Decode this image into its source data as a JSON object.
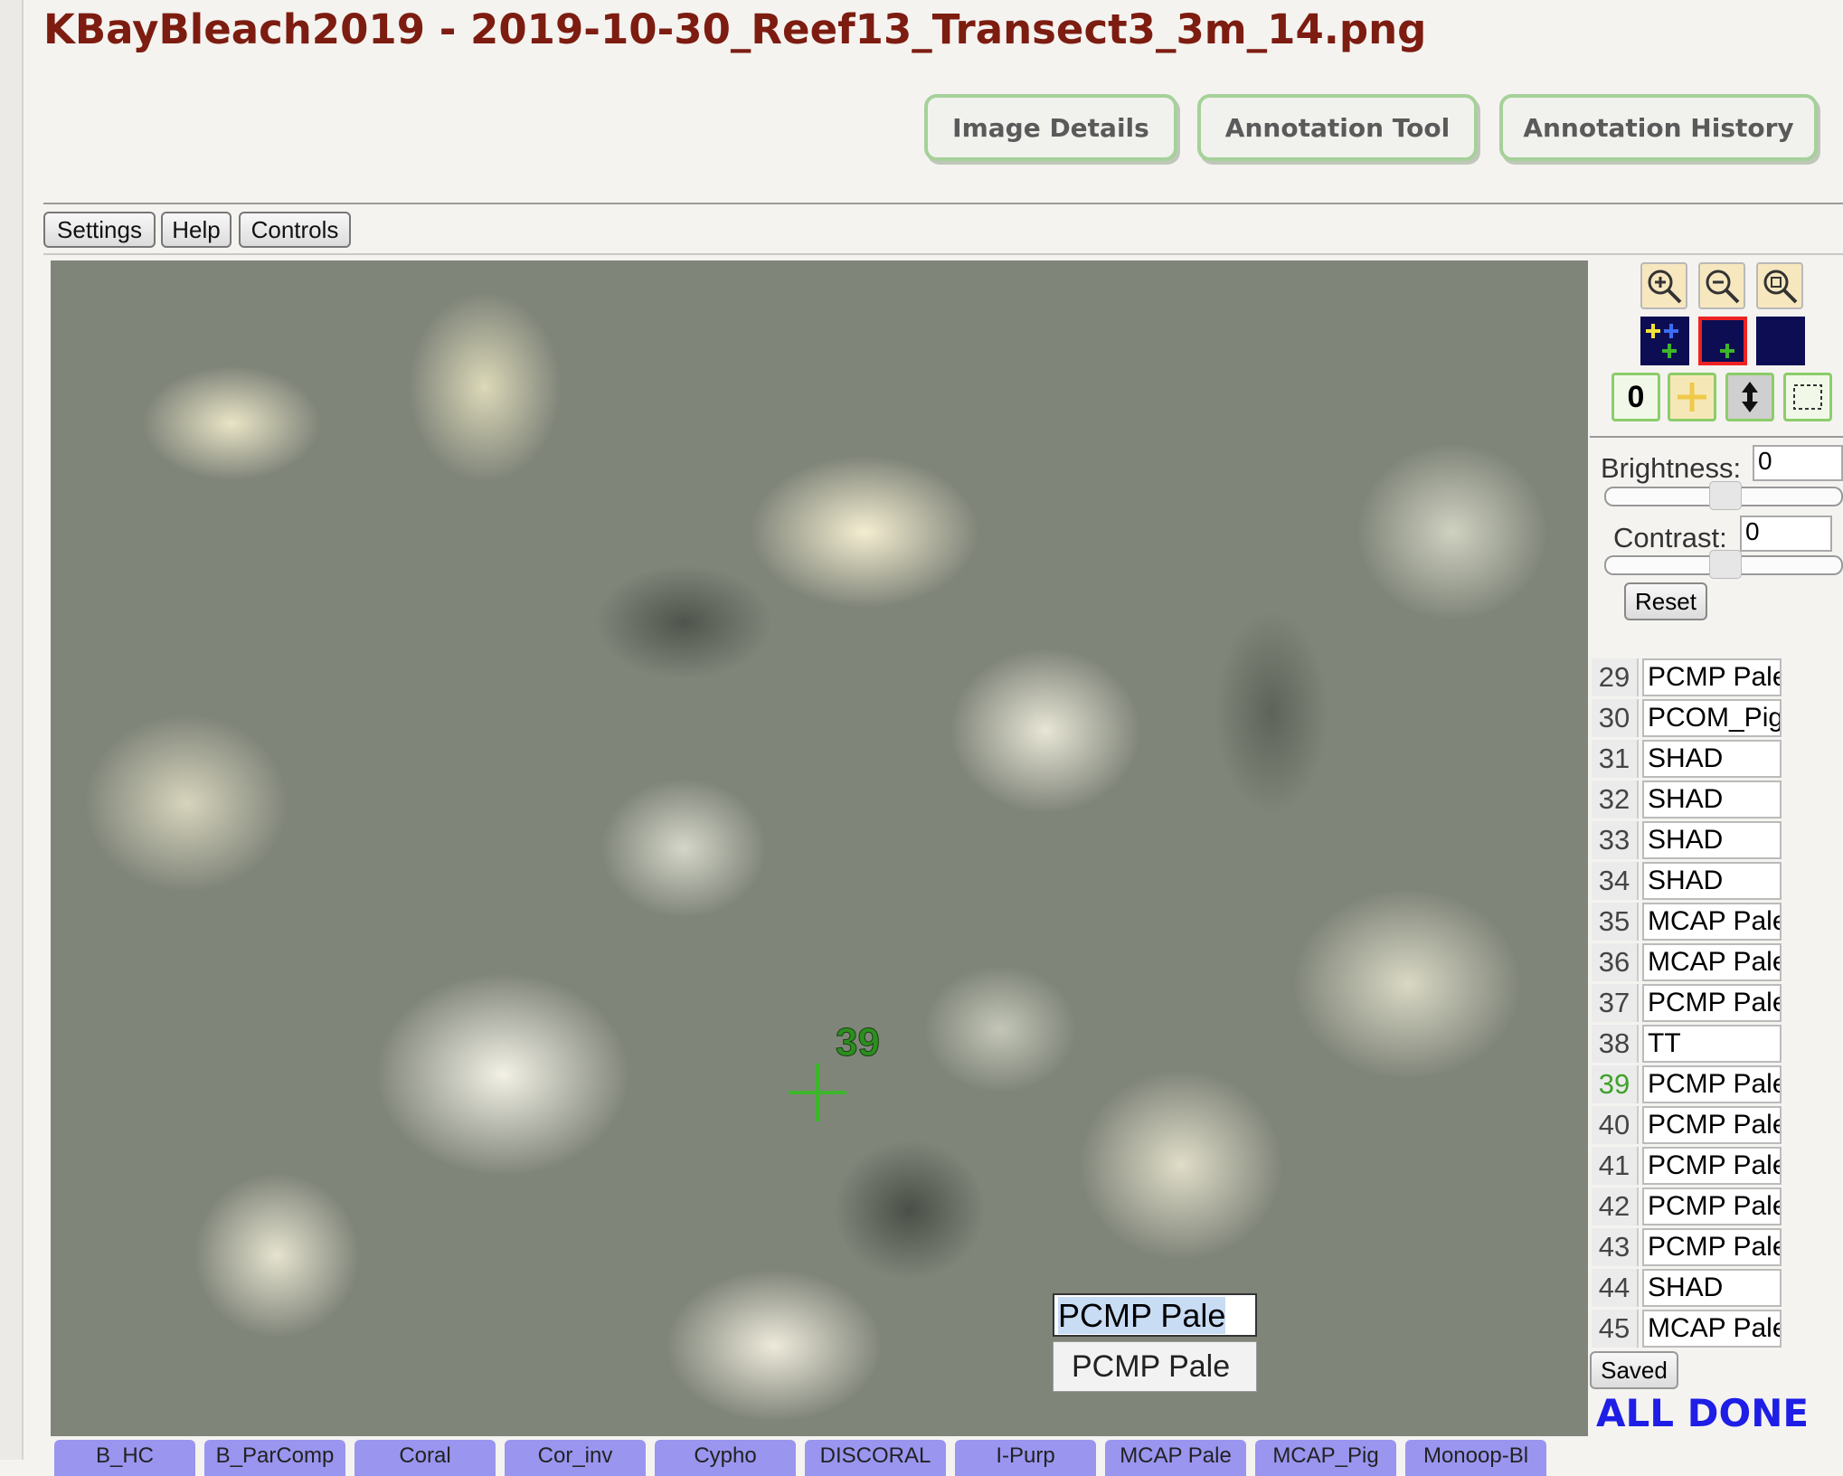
{
  "header": {
    "title": "KBayBleach2019 - 2019-10-30_Reef13_Transect3_3m_14.png",
    "nav": [
      "Image Details",
      "Annotation Tool",
      "Annotation History"
    ]
  },
  "toolbar": {
    "settings_label": "Settings",
    "help_label": "Help",
    "controls_label": "Controls"
  },
  "canvas": {
    "marker_number": "39",
    "label_input_value": "PCMP Pale",
    "suggestion": "PCMP Pale"
  },
  "tools": {
    "zoom_icons": [
      "zoom-in-icon",
      "zoom-out-icon",
      "zoom-fit-icon"
    ],
    "mode_icons": [
      "all-points-icon",
      "selected-point-icon",
      "no-points-icon"
    ],
    "counter_label": "0",
    "bottom_icons": [
      "crosshair-icon",
      "vertical-arrows-icon",
      "dashed-box-icon"
    ]
  },
  "adjust": {
    "brightness_label": "Brightness:",
    "brightness_value": "0",
    "contrast_label": "Contrast:",
    "contrast_value": "0",
    "reset_label": "Reset"
  },
  "points": [
    {
      "num": "29",
      "label": "PCMP Pale"
    },
    {
      "num": "30",
      "label": "PCOM_Pig"
    },
    {
      "num": "31",
      "label": "SHAD"
    },
    {
      "num": "32",
      "label": "SHAD"
    },
    {
      "num": "33",
      "label": "SHAD"
    },
    {
      "num": "34",
      "label": "SHAD"
    },
    {
      "num": "35",
      "label": "MCAP Pale"
    },
    {
      "num": "36",
      "label": "MCAP Pale"
    },
    {
      "num": "37",
      "label": "PCMP Pale"
    },
    {
      "num": "38",
      "label": "TT"
    },
    {
      "num": "39",
      "label": "PCMP Pale"
    },
    {
      "num": "40",
      "label": "PCMP Pale"
    },
    {
      "num": "41",
      "label": "PCMP Pale"
    },
    {
      "num": "42",
      "label": "PCMP Pale"
    },
    {
      "num": "43",
      "label": "PCMP Pale"
    },
    {
      "num": "44",
      "label": "SHAD"
    },
    {
      "num": "45",
      "label": "MCAP Pale"
    }
  ],
  "status": {
    "saved_label": "Saved",
    "all_done": "ALL DONE"
  },
  "label_tabs": [
    "B_HC",
    "B_ParComp",
    "Coral",
    "Cor_inv",
    "Cypho",
    "DISCORAL",
    "I-Purp",
    "MCAP Pale",
    "MCAP_Pig",
    "Monoop-Bl"
  ],
  "colors": {
    "title": "#7d1c10",
    "nav_border": "#a6d19a",
    "marker": "#2b8f1e",
    "label_tab": "#9a95ef",
    "all_done": "#1e1ee6",
    "mode_button": "#0c0d52"
  }
}
